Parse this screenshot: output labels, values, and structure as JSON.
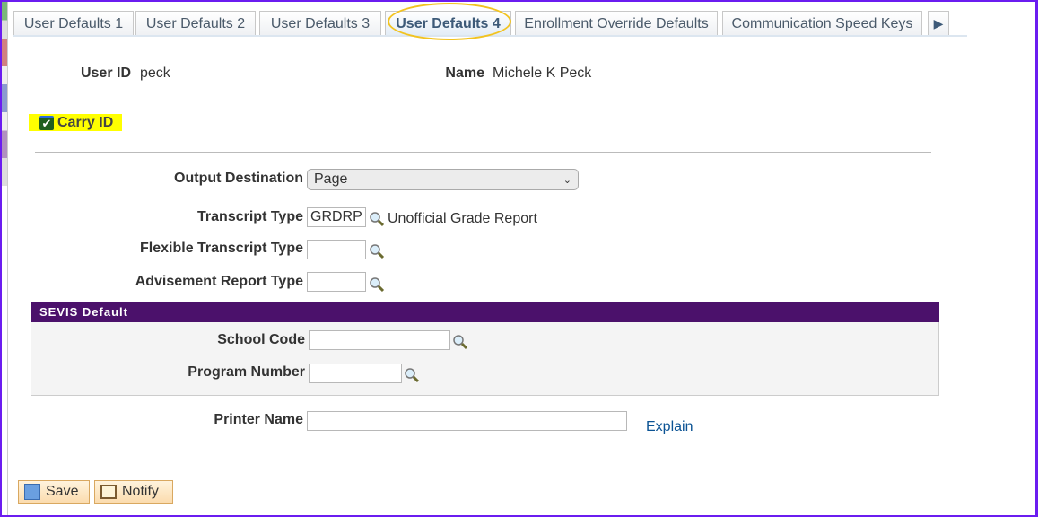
{
  "tabs": [
    {
      "label": "User Defaults 1"
    },
    {
      "label": "User Defaults 2"
    },
    {
      "label": "User Defaults 3"
    },
    {
      "label": "User Defaults 4",
      "active": true
    },
    {
      "label": "Enrollment Override Defaults"
    },
    {
      "label": "Communication Speed Keys"
    }
  ],
  "user": {
    "id_label": "User ID",
    "id": "peck",
    "name_label": "Name",
    "name": "Michele K Peck"
  },
  "carry_id": {
    "label": "Carry ID",
    "checked": true
  },
  "output_destination": {
    "label": "Output Destination",
    "value": "Page"
  },
  "transcript_type": {
    "label": "Transcript Type",
    "value": "GRDRP",
    "description": "Unofficial Grade Report"
  },
  "flexible_transcript_type": {
    "label": "Flexible Transcript Type",
    "value": ""
  },
  "advisement_report_type": {
    "label": "Advisement Report Type",
    "value": ""
  },
  "sevis": {
    "title": "SEVIS Default",
    "school_code_label": "School Code",
    "school_code": "",
    "program_number_label": "Program Number",
    "program_number": ""
  },
  "printer": {
    "label": "Printer Name",
    "value": "",
    "explain": "Explain"
  },
  "buttons": {
    "save": "Save",
    "notify": "Notify"
  },
  "colors": {
    "sevis_header": "#4b116b",
    "highlight": "#ffff00",
    "link": "#0b5394"
  }
}
